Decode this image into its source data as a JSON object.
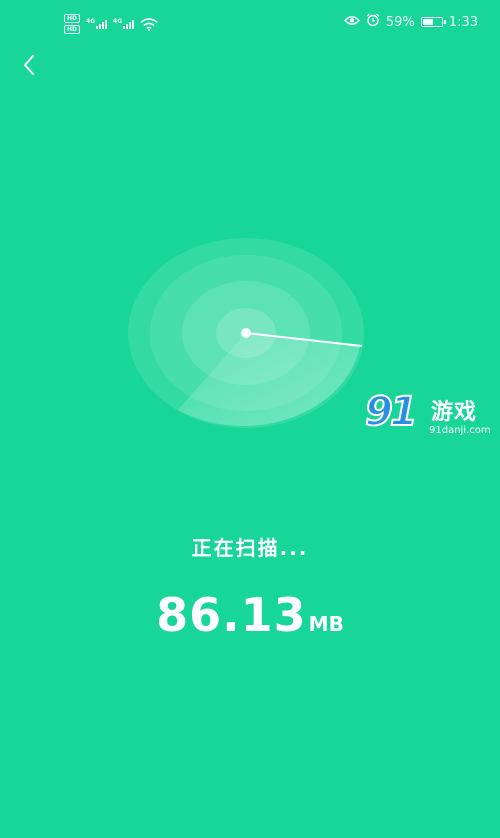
{
  "status_bar": {
    "left_badges": [
      "HD",
      "HD"
    ],
    "network_label_1": "4G",
    "network_label_2": "4G",
    "battery_percent": "59%",
    "battery_level": 0.59,
    "time": "1:33",
    "icons": [
      "eye-icon",
      "alarm-icon",
      "battery-icon",
      "wifi-icon"
    ]
  },
  "nav": {
    "back_icon": "chevron-left-icon"
  },
  "scan": {
    "status_text": "正在扫描...",
    "size_value": "86.13",
    "size_unit": "MB"
  },
  "watermark": {
    "logo": "91",
    "title": "游戏",
    "url": "91danji.com"
  },
  "colors": {
    "background": "#17d697",
    "text": "#ffffff",
    "watermark_blue": "#2a8fe0"
  }
}
